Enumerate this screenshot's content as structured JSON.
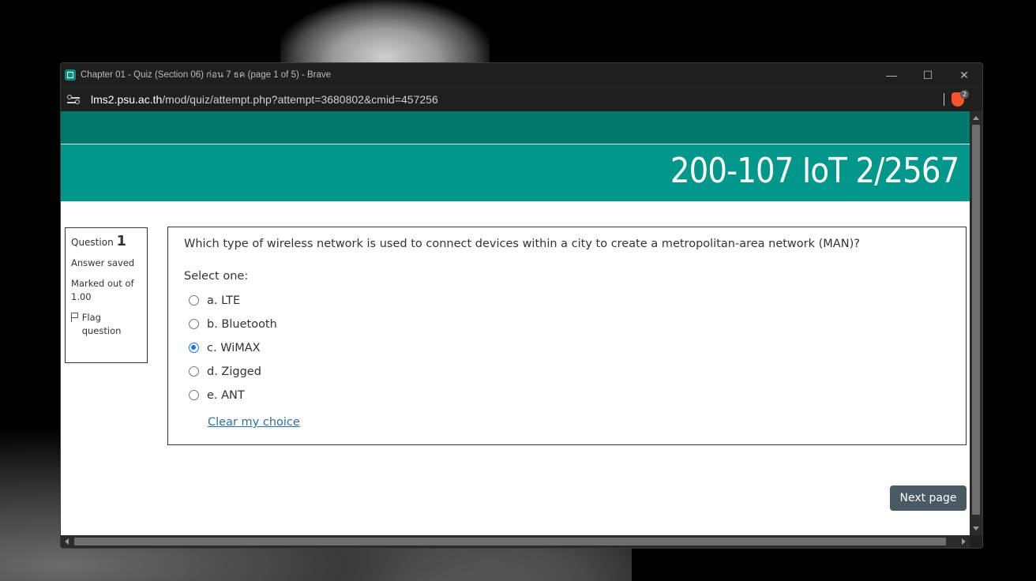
{
  "window": {
    "title": "Chapter 01 - Quiz (Section 06) ก่อน 7 ธค (page 1 of 5) - Brave",
    "controls": {
      "minimize": "—",
      "maximize": "☐",
      "close": "✕"
    }
  },
  "addressbar": {
    "host": "lms2.psu.ac.th",
    "path": "/mod/quiz/attempt.php?attempt=3680802&cmid=457256",
    "brave_badge": "2"
  },
  "header": {
    "course_title": "200-107 IoT 2/2567",
    "colors": {
      "top": "#01786a",
      "main": "#01978a"
    }
  },
  "question_info": {
    "label": "Question",
    "number": "1",
    "state": "Answer saved",
    "grade": "Marked out of 1.00",
    "flag": "Flag question"
  },
  "question": {
    "text": "Which type of wireless network is used to connect devices within a city to create a metropolitan-area network (MAN)?",
    "prompt": "Select one:",
    "options": [
      {
        "label": "a. LTE",
        "selected": false
      },
      {
        "label": "b. Bluetooth",
        "selected": false
      },
      {
        "label": "c. WiMAX",
        "selected": true
      },
      {
        "label": "d. Zigged",
        "selected": false
      },
      {
        "label": "e. ANT",
        "selected": false
      }
    ],
    "clear_choice": "Clear my choice"
  },
  "navigation": {
    "next_page": "Next page"
  }
}
